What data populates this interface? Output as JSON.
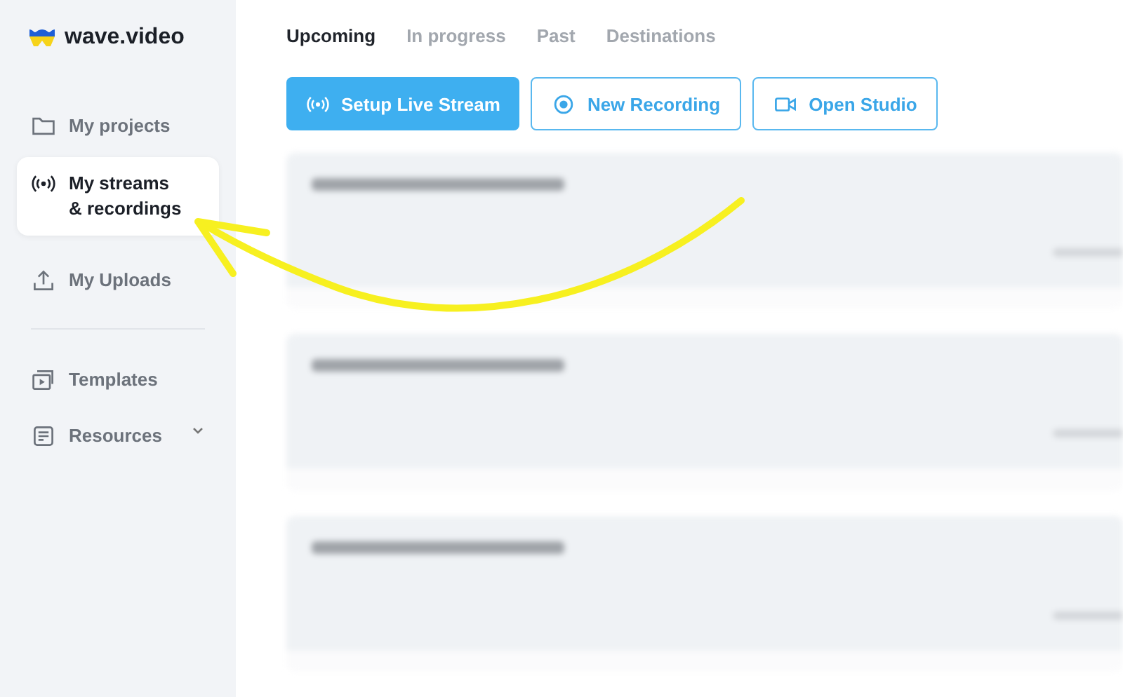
{
  "brand": {
    "name": "wave.video"
  },
  "sidebar": {
    "items": [
      {
        "label": "My projects",
        "selected": false
      },
      {
        "label": "My streams\n& recordings",
        "selected": true
      },
      {
        "label": "My Uploads",
        "selected": false
      },
      {
        "label": "Templates",
        "selected": false
      },
      {
        "label": "Resources",
        "selected": false,
        "expandable": true
      }
    ]
  },
  "tabs": [
    {
      "label": "Upcoming",
      "selected": true
    },
    {
      "label": "In progress",
      "selected": false
    },
    {
      "label": "Past",
      "selected": false
    },
    {
      "label": "Destinations",
      "selected": false
    }
  ],
  "actions": [
    {
      "label": "Setup Live Stream",
      "kind": "primary"
    },
    {
      "label": "New Recording",
      "kind": "outline"
    },
    {
      "label": "Open Studio",
      "kind": "outline"
    }
  ],
  "content_cards": [
    {
      "kind": "blurred"
    },
    {
      "kind": "blurred"
    },
    {
      "kind": "blurred"
    }
  ],
  "annotation": {
    "kind": "arrow"
  }
}
